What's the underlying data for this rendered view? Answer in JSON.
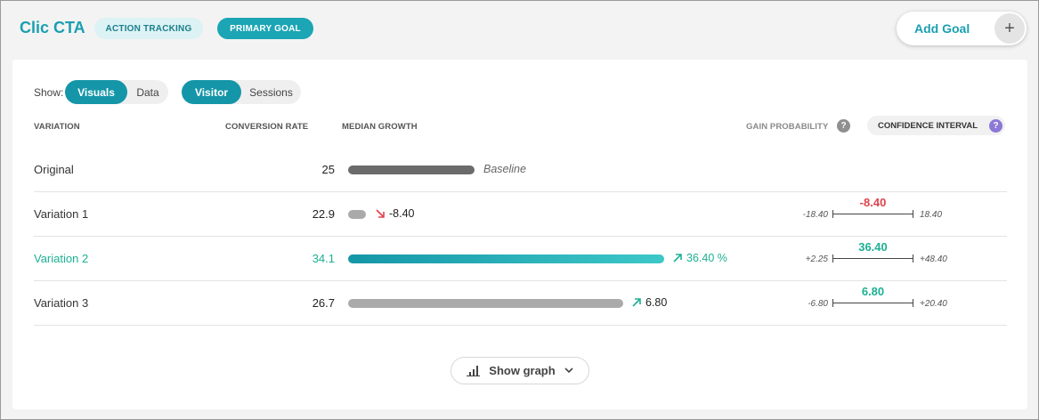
{
  "header": {
    "title": "Clic CTA",
    "chip_action": "ACTION TRACKING",
    "chip_primary": "PRIMARY GOAL",
    "add_goal": "Add Goal",
    "add_goal_icon": "plus-icon"
  },
  "controls": {
    "show_label": "Show:",
    "view_options": [
      "Visuals",
      "Data"
    ],
    "view_selected": "Visuals",
    "unit_options": [
      "Visitor",
      "Sessions"
    ],
    "unit_selected": "Visitor"
  },
  "columns": {
    "variation": "VARIATION",
    "conversion_rate": "CONVERSION RATE",
    "median_growth": "MEDIAN GROWTH",
    "gain_probability": "GAIN PROBABILITY",
    "confidence_interval": "CONFIDENCE INTERVAL",
    "help_glyph": "?"
  },
  "rows": [
    {
      "name": "Original",
      "rate": "25",
      "growth_label": "Baseline",
      "bar_fraction": 0.4
    },
    {
      "name": "Variation 1",
      "rate": "22.9",
      "growth_label": "-8.40",
      "trend": "down",
      "bar_fraction": 0.06,
      "ci_low": "-18.40",
      "ci_mid": "-8.40",
      "ci_high": "18.40"
    },
    {
      "name": "Variation 2",
      "rate": "34.1",
      "growth_label": "36.40 %",
      "trend": "up",
      "bar_fraction": 1.0,
      "ci_low": "+2.25",
      "ci_mid": "36.40",
      "ci_high": "+48.40"
    },
    {
      "name": "Variation 3",
      "rate": "26.7",
      "growth_label": "6.80",
      "trend": "up",
      "bar_fraction": 0.87,
      "ci_low": "-6.80",
      "ci_mid": "6.80",
      "ci_high": "+20.40"
    }
  ],
  "colors": {
    "accent": "#1596a8",
    "winner": "#1bb193",
    "negative": "#e0434b",
    "ci_help": "#8c78d6"
  },
  "footer": {
    "show_graph": "Show graph",
    "graph_icon": "bar-chart-icon",
    "chevron_icon": "chevron-down-icon"
  }
}
